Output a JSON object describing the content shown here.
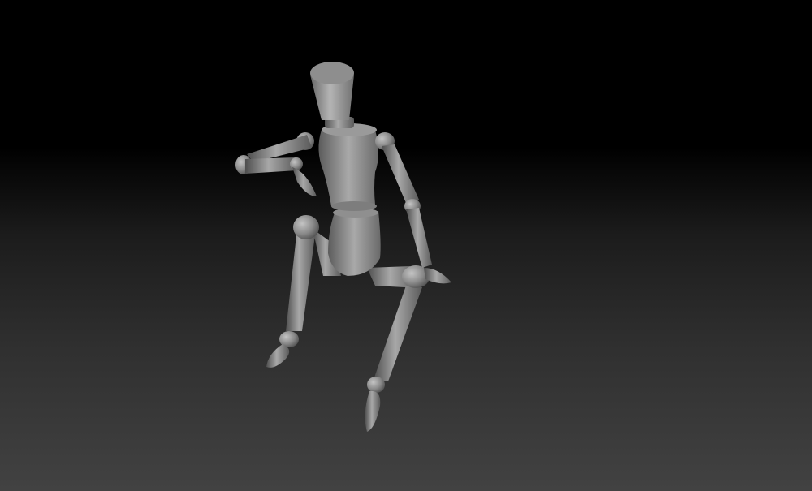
{
  "scene": {
    "subject": "wooden-mannequin",
    "pose": "seated",
    "background_top": "#000000",
    "background_bottom": "#424242",
    "material_color": "#8a8a8a"
  }
}
